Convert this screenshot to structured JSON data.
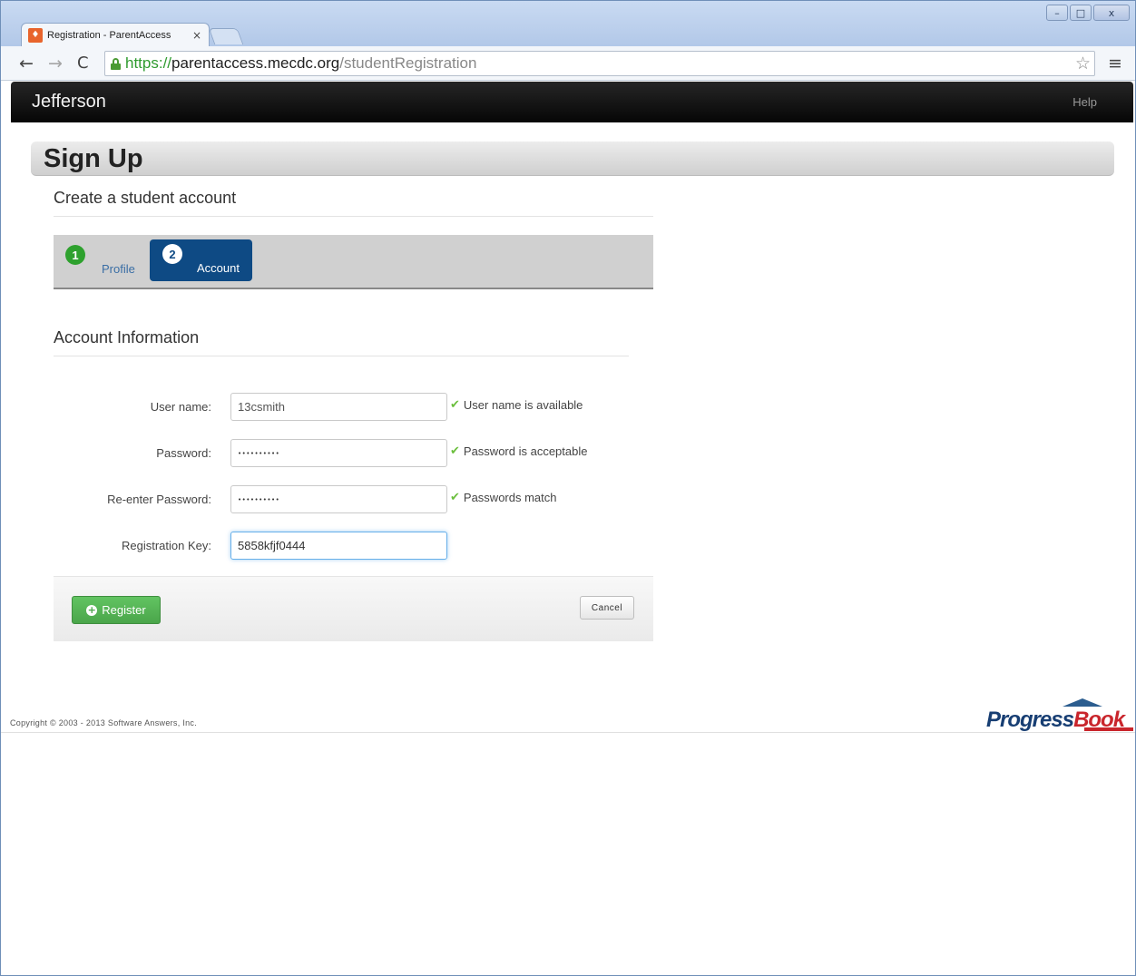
{
  "browser": {
    "tab_title": "Registration - ParentAccess",
    "tab_close": "×",
    "favicon_glyph": "♦",
    "url_scheme": "https://",
    "url_host": "parentaccess.mecdc.org",
    "url_path": "/studentRegistration",
    "icons": {
      "back": "←",
      "forward": "→",
      "reload": "C",
      "star": "☆",
      "menu": "≡",
      "minimize": "–",
      "maximize": "□",
      "close": "x"
    }
  },
  "navbar": {
    "brand": "Jefferson",
    "help": "Help"
  },
  "page": {
    "title": "Sign Up",
    "subtitle": "Create a student account"
  },
  "wizard": {
    "steps": [
      {
        "number": "1",
        "label": "Profile"
      },
      {
        "number": "2",
        "label": "Account"
      }
    ]
  },
  "account": {
    "heading": "Account Information",
    "fields": {
      "username": {
        "label": "User name:",
        "value": "13csmith",
        "status": "User name is available"
      },
      "password": {
        "label": "Password:",
        "value": "••••••••••",
        "status": "Password is acceptable"
      },
      "repassword": {
        "label": "Re-enter Password:",
        "value": "••••••••••",
        "status": "Passwords match"
      },
      "regkey": {
        "label": "Registration Key:",
        "value": "5858kfjf0444"
      }
    },
    "check_glyph": "✔"
  },
  "actions": {
    "register": "Register",
    "plus_glyph": "+",
    "cancel": "Cancel"
  },
  "footer": {
    "copyright": "Copyright © 2003 - 2013 Software Answers, Inc.",
    "logo_progress": "Progress",
    "logo_book": "Book"
  },
  "colors": {
    "navbar": "#0a0a0a",
    "active_step": "#0e4a84",
    "complete_step": "#2ea12e",
    "register_btn": "#5cb85c",
    "check": "#6bbf3d"
  }
}
